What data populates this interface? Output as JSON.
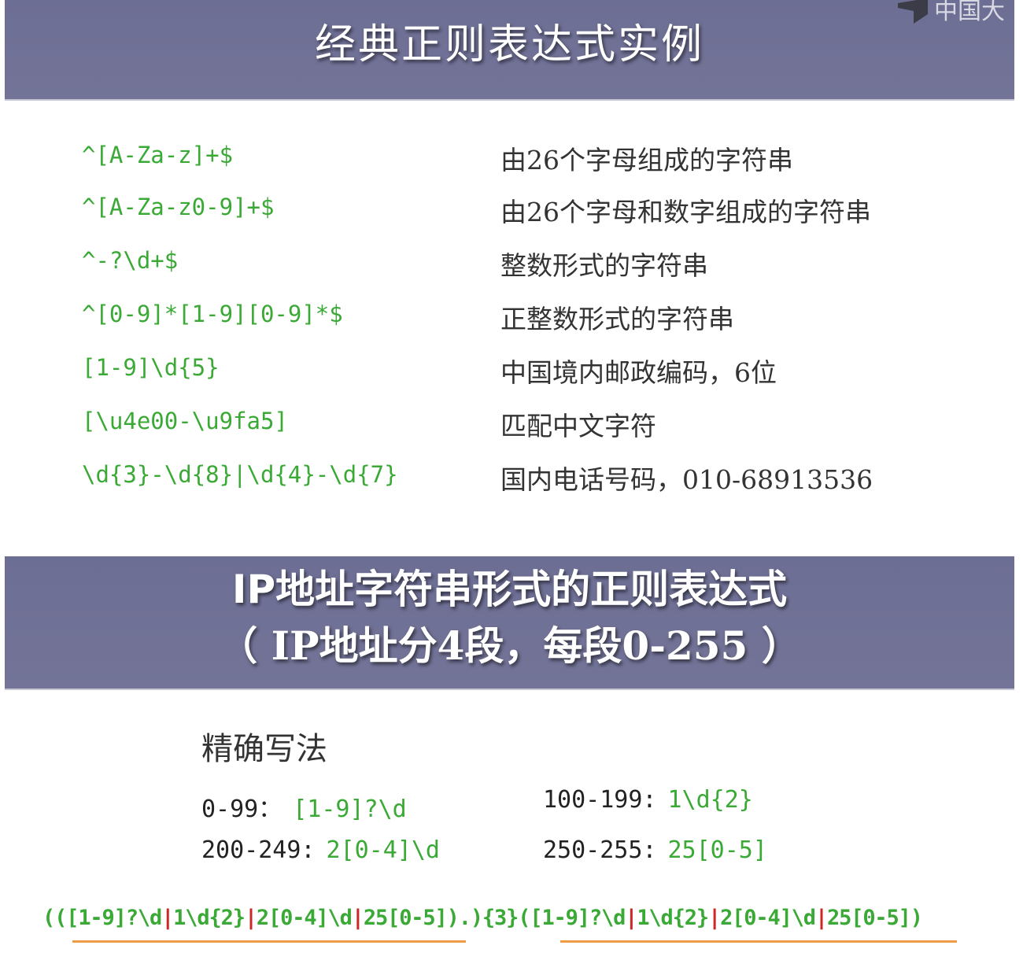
{
  "slide1": {
    "title": "经典正则表达式实例",
    "logo_text": "中国大",
    "rows": [
      {
        "pattern": "^[A-Za-z]+$",
        "description": "由26个字母组成的字符串"
      },
      {
        "pattern": "^[A-Za-z0-9]+$",
        "description": "由26个字母和数字组成的字符串"
      },
      {
        "pattern": "^-?\\d+$",
        "description": "整数形式的字符串"
      },
      {
        "pattern": "^[0-9]*[1-9][0-9]*$",
        "description": "正整数形式的字符串"
      },
      {
        "pattern": "[1-9]\\d{5}",
        "description": "中国境内邮政编码，6位"
      },
      {
        "pattern": "[\\u4e00-\\u9fa5]",
        "description": "匹配中文字符"
      },
      {
        "pattern": "\\d{3}-\\d{8}|\\d{4}-\\d{7}",
        "description": "国内电话号码，010-68913536"
      }
    ]
  },
  "slide2": {
    "title_line1": "IP地址字符串形式的正则表达式",
    "title_line2": "（ IP地址分4段，每段0-255 ）",
    "subheading": "精确写法",
    "ranges": [
      {
        "range": "0-99：",
        "pattern": "[1-9]?\\d"
      },
      {
        "range": "100-199:",
        "pattern": "1\\d{2}"
      },
      {
        "range": "200-249:",
        "pattern": "2[0-4]\\d"
      },
      {
        "range": "250-255:",
        "pattern": "25[0-5]"
      }
    ],
    "full_expression_parts": [
      "(([1-9]?\\d",
      "|",
      "1\\d{2}",
      "|",
      "2[0-4]\\d",
      "|",
      "25[0-5]).){3}([1-9]?\\d",
      "|",
      "1\\d{2}",
      "|",
      "2[0-4]\\d",
      "|",
      "25[0-5])"
    ]
  }
}
